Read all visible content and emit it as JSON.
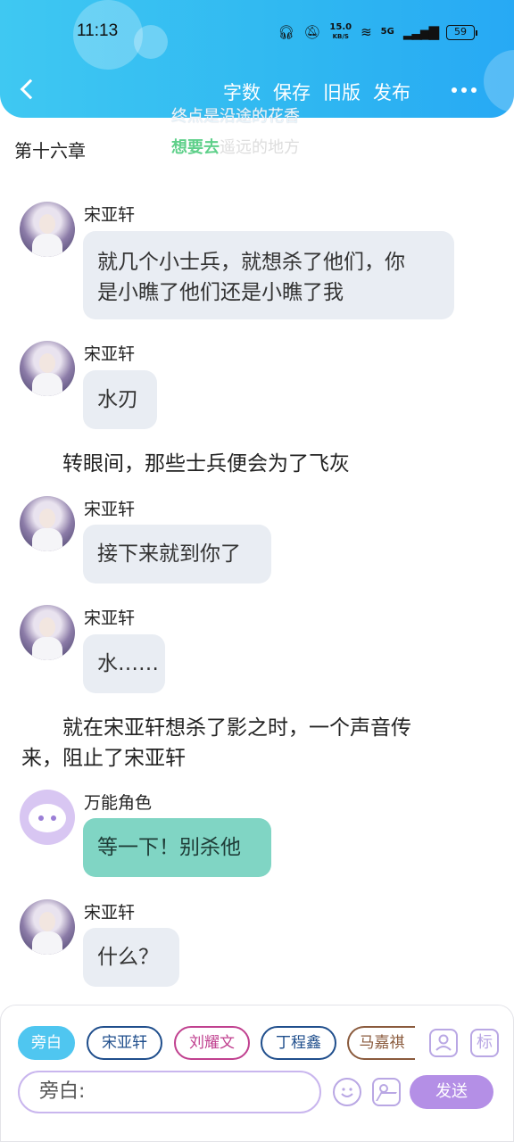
{
  "status_bar": {
    "time": "11:13",
    "speed": "15.0",
    "speed_unit": "KB/S",
    "network": "5G",
    "battery": "59",
    "icons": [
      "headphones-icon",
      "mute-bell-icon",
      "wifi-icon",
      "signal-icon"
    ]
  },
  "header": {
    "back_icon": "chevron-left-icon",
    "actions": [
      "字数",
      "保存",
      "旧版",
      "发布"
    ],
    "more_icon": "more-dots-icon",
    "lyric_line1": "终点是沿途的花香",
    "lyric_line2_highlight": "想要去",
    "lyric_line2_rest": "遥远的地方"
  },
  "chapter_title": "第十六章",
  "messages": [
    {
      "type": "chat",
      "name": "宋亚轩",
      "lines": [
        "就几个小士兵，就想杀了他们，你",
        "是小瞧了他们还是小瞧了我"
      ]
    },
    {
      "type": "chat",
      "name": "宋亚轩",
      "lines": [
        "水刃"
      ]
    },
    {
      "type": "narration",
      "lines": [
        "转眼间，那些士兵便会为了飞灰"
      ]
    },
    {
      "type": "chat",
      "name": "宋亚轩",
      "lines": [
        "接下来就到你了"
      ]
    },
    {
      "type": "chat",
      "name": "宋亚轩",
      "lines": [
        "水……"
      ]
    },
    {
      "type": "narration",
      "lines": [
        "就在宋亚轩想杀了影之时，一个声音传",
        "来，阻止了宋亚轩"
      ]
    },
    {
      "type": "chat",
      "name": "万能角色",
      "lines": [
        "等一下！别杀他"
      ],
      "bubble_color": "#80d5c4"
    },
    {
      "type": "chat",
      "name": "宋亚轩",
      "lines": [
        "什么？"
      ]
    }
  ],
  "composer": {
    "roles": [
      {
        "label": "旁白",
        "color": "#4fc6f0",
        "active": true
      },
      {
        "label": "宋亚轩",
        "color": "#1f4e8c"
      },
      {
        "label": "刘耀文",
        "color": "#c0408f"
      },
      {
        "label": "丁程鑫",
        "color": "#1f4e8c"
      },
      {
        "label": "马嘉祺",
        "color": "#8a5a3c"
      }
    ],
    "role_manage_icon": "person-icon",
    "tag_label": "标",
    "input_prefix": "旁白:",
    "emoji_icon": "smile-icon",
    "image_icon": "image-icon",
    "send_label": "发送"
  },
  "colors": {
    "header": "#2fb7f1",
    "accent": "#b48fe6",
    "bubble": "#e9edf3"
  }
}
